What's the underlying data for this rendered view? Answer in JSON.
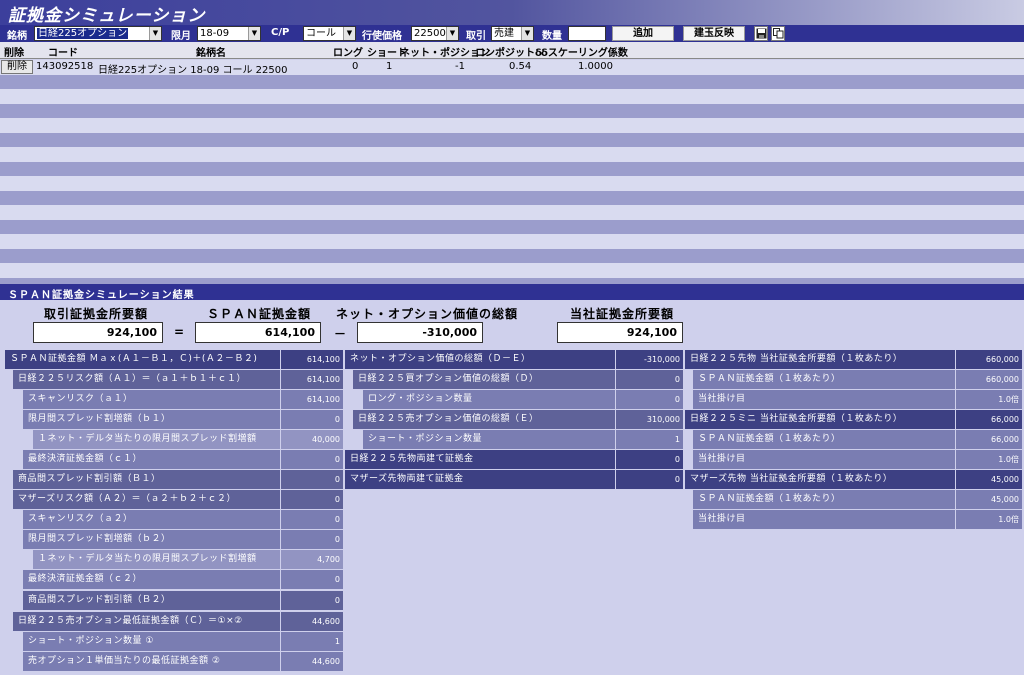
{
  "window": {
    "title": "証拠金シミュレーション"
  },
  "toolbar": {
    "issue_label": "銘柄",
    "issue_value": "日経225オプション",
    "month_label": "限月",
    "month_value": "18-09",
    "cp_label": "C/P",
    "cp_value": "コール",
    "strike_label": "行使価格",
    "strike_value": "22500",
    "trade_label": "取引",
    "trade_value": "売建",
    "qty_label": "数量",
    "add_button": "追加",
    "reflect_button": "建玉反映",
    "save_icon": "save-icon",
    "copy_icon": "copy-icon"
  },
  "grid": {
    "headers": [
      "削除",
      "コード",
      "銘柄名",
      "ロング",
      "ショート",
      "ネット・ポジション",
      "コンポジットδ",
      "δスケーリング係数"
    ],
    "rows": [
      {
        "delete": "削除",
        "code": "143092518",
        "name": "日経225オプション 18-09 コール 22500",
        "long": "0",
        "short": "1",
        "net": "-1",
        "delta": "0.54",
        "scaling": "1.0000"
      }
    ]
  },
  "result": {
    "section_title": "ＳＰＡＮ証拠金シミュレーション結果",
    "summary": {
      "required_label": "取引証拠金所要額",
      "required_value": "924,100",
      "span_label": "ＳＰＡＮ証拠金額",
      "span_value": "614,100",
      "net_option_label": "ネット・オプション価値の総額",
      "net_option_value": "-310,000",
      "company_label": "当社証拠金所要額",
      "company_value": "924,100",
      "eq": "=",
      "minus": "－"
    },
    "col1": [
      {
        "label": "ＳＰＡＮ証拠金額 Ｍａｘ(Ａ１－Ｂ１，Ｃ)＋(Ａ２－Ｂ２)",
        "value": "614,100"
      },
      {
        "label": "日経２２５リスク額（Ａ１）＝（ａ１＋ｂ１＋ｃ１）",
        "value": "614,100"
      },
      {
        "label": "スキャンリスク（ａ１）",
        "value": "614,100"
      },
      {
        "label": "限月間スプレッド割増額（ｂ１）",
        "value": "0"
      },
      {
        "label": "１ネット・デルタ当たりの限月間スプレッド割増額",
        "value": "40,000"
      },
      {
        "label": "最終決済証拠金額（ｃ１）",
        "value": "0"
      },
      {
        "label": "商品間スプレッド割引額（Ｂ１）",
        "value": "0"
      },
      {
        "label": "マザーズリスク額（Ａ２）＝（ａ２＋ｂ２＋ｃ２）",
        "value": "0"
      },
      {
        "label": "スキャンリスク（ａ２）",
        "value": "0"
      },
      {
        "label": "限月間スプレッド割増額（ｂ２）",
        "value": "0"
      },
      {
        "label": "１ネット・デルタ当たりの限月間スプレッド割増額",
        "value": "4,700"
      },
      {
        "label": "最終決済証拠金額（ｃ２）",
        "value": "0"
      },
      {
        "label": "商品間スプレッド割引額（Ｂ２）",
        "value": "0"
      },
      {
        "label": "日経２２５売オプション最低証拠金額（Ｃ）＝①×②",
        "value": "44,600"
      },
      {
        "label": "ショート・ポジション数量 ①",
        "value": "1"
      },
      {
        "label": "売オプション１単価当たりの最低証拠金額 ②",
        "value": "44,600"
      }
    ],
    "col2": [
      {
        "label": "ネット・オプション価値の総額（Ｄ－Ｅ）",
        "value": "-310,000"
      },
      {
        "label": "日経２２５買オプション価値の総額（Ｄ）",
        "value": "0"
      },
      {
        "label": "ロング・ポジション数量",
        "value": "0"
      },
      {
        "label": "日経２２５売オプション価値の総額（Ｅ）",
        "value": "310,000"
      },
      {
        "label": "ショート・ポジション数量",
        "value": "1"
      },
      {
        "label": "日経２２５先物両建て証拠金",
        "value": "0"
      },
      {
        "label": "マザーズ先物両建て証拠金",
        "value": "0"
      }
    ],
    "col3": [
      {
        "label": "日経２２５先物 当社証拠金所要額（１枚あたり）",
        "value": "660,000"
      },
      {
        "label": "ＳＰＡＮ証拠金額（１枚あたり）",
        "value": "660,000"
      },
      {
        "label": "当社掛け目",
        "value": "1.0倍"
      },
      {
        "label": "日経２２５ミニ 当社証拠金所要額（１枚あたり）",
        "value": "66,000"
      },
      {
        "label": "ＳＰＡＮ証拠金額（１枚あたり）",
        "value": "66,000"
      },
      {
        "label": "当社掛け目",
        "value": "1.0倍"
      },
      {
        "label": "マザーズ先物 当社証拠金所要額（１枚あたり）",
        "value": "45,000"
      },
      {
        "label": "ＳＰＡＮ証拠金額（１枚あたり）",
        "value": "45,000"
      },
      {
        "label": "当社掛け目",
        "value": "1.0倍"
      }
    ]
  }
}
